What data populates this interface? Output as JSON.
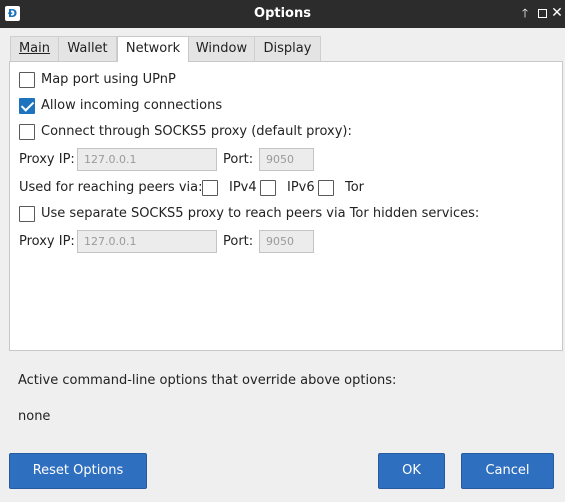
{
  "window": {
    "title": "Options",
    "app_icon_glyph": "Đ"
  },
  "tabs": [
    "Main",
    "Wallet",
    "Network",
    "Window",
    "Display"
  ],
  "active_tab": "Network",
  "network": {
    "upnp_label": "Map port using UPnP",
    "upnp_checked": false,
    "incoming_label": "Allow incoming connections",
    "incoming_checked": true,
    "socks_label": "Connect through SOCKS5 proxy (default proxy):",
    "socks_checked": false,
    "proxy_ip_label": "Proxy IP:",
    "proxy_ip_value": "127.0.0.1",
    "port_label": "Port:",
    "port_value": "9050",
    "reach_label": "Used for reaching peers via:",
    "ipv4_label": "IPv4",
    "ipv6_label": "IPv6",
    "tor_label": "Tor",
    "separate_label": "Use separate SOCKS5 proxy to reach peers via Tor hidden services:",
    "separate_checked": false,
    "tor_proxy_ip_label": "Proxy IP:",
    "tor_proxy_ip_value": "127.0.0.1",
    "tor_port_label": "Port:",
    "tor_port_value": "9050"
  },
  "overrides": {
    "label": "Active command-line options that override above options:",
    "value": "none"
  },
  "buttons": {
    "reset": "Reset Options",
    "ok": "OK",
    "cancel": "Cancel"
  },
  "icons": [
    "app-logo-icon",
    "maximize-up-icon",
    "restore-icon",
    "close-icon"
  ],
  "colors": {
    "titlebar": "#2c2c2c",
    "accent": "#2f6fc0"
  }
}
